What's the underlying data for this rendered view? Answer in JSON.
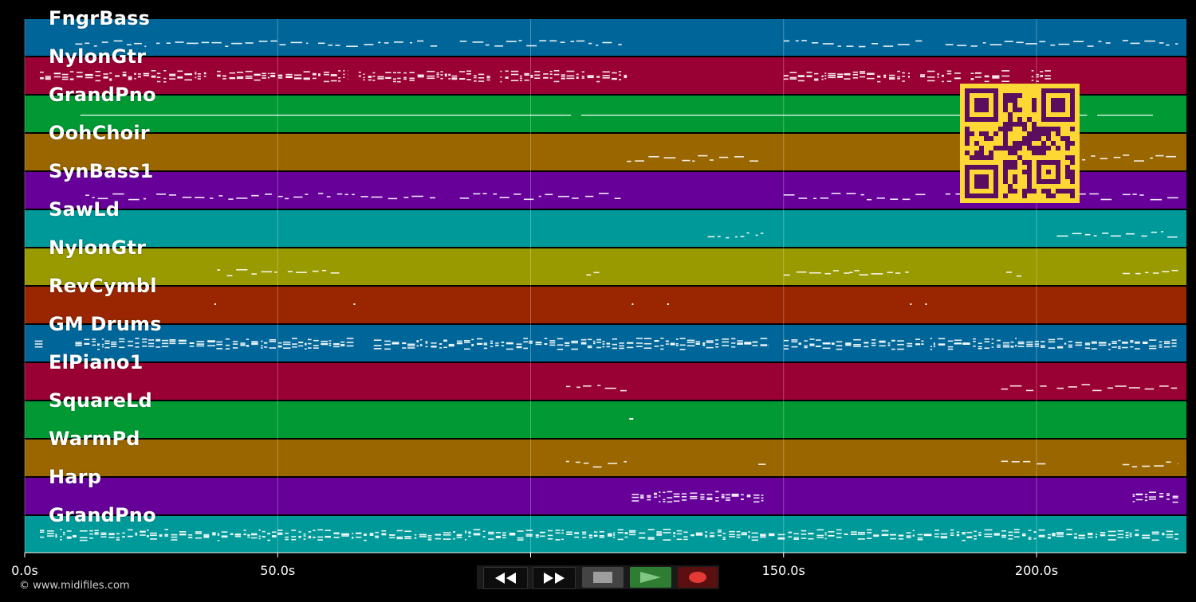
{
  "tracks": [
    {
      "name": "FngrBass",
      "color": "#006699",
      "notes": [
        [
          10,
          24
        ],
        [
          26,
          56
        ],
        [
          58,
          82
        ],
        [
          86,
          118
        ],
        [
          150,
          178
        ],
        [
          182,
          215
        ],
        [
          217,
          228
        ]
      ],
      "density": "sparse"
    },
    {
      "name": "NylonGtr",
      "color": "#990033",
      "notes": [
        [
          3,
          36
        ],
        [
          38,
          64
        ],
        [
          66,
          92
        ],
        [
          94,
          119
        ],
        [
          150,
          175
        ],
        [
          177,
          185
        ],
        [
          187,
          195
        ],
        [
          199,
          203
        ]
      ],
      "density": "dense"
    },
    {
      "name": "GrandPno",
      "color": "#009933",
      "notes": [
        [
          11,
          108
        ],
        [
          110,
          210
        ],
        [
          212,
          223
        ]
      ],
      "density": "line"
    },
    {
      "name": "OohChoir",
      "color": "#996600",
      "notes": [
        [
          119,
          145
        ],
        [
          209,
          228
        ]
      ],
      "density": "sparse"
    },
    {
      "name": "SynBass1",
      "color": "#660099",
      "notes": [
        [
          12,
          24
        ],
        [
          26,
          56
        ],
        [
          58,
          82
        ],
        [
          86,
          118
        ],
        [
          150,
          178
        ],
        [
          182,
          215
        ],
        [
          217,
          228
        ]
      ],
      "density": "sparse"
    },
    {
      "name": "SawLd",
      "color": "#009999",
      "notes": [
        [
          135,
          146
        ],
        [
          204,
          228
        ]
      ],
      "density": "sparse"
    },
    {
      "name": "NylonGtr",
      "color": "#999900",
      "notes": [
        [
          38,
          50
        ],
        [
          52,
          63
        ],
        [
          111,
          114
        ],
        [
          150,
          165
        ],
        [
          163,
          175
        ],
        [
          194,
          197
        ],
        [
          217,
          228
        ]
      ],
      "density": "sparse"
    },
    {
      "name": "RevCymbl",
      "color": "#992600",
      "notes": [
        [
          37.5,
          37.8
        ],
        [
          65,
          65.3
        ],
        [
          120,
          120.3
        ],
        [
          127,
          127.3
        ],
        [
          175,
          175.3
        ],
        [
          178,
          178.3
        ]
      ],
      "density": "dots"
    },
    {
      "name": "GM Drums",
      "color": "#006699",
      "notes": [
        [
          2,
          4
        ],
        [
          10,
          65
        ],
        [
          69,
          119
        ],
        [
          119,
          147
        ],
        [
          150,
          178
        ],
        [
          179,
          228
        ]
      ],
      "density": "dense"
    },
    {
      "name": "ElPiano1",
      "color": "#990033",
      "notes": [
        [
          107,
          119
        ],
        [
          193,
          202
        ],
        [
          204,
          228
        ]
      ],
      "density": "sparse"
    },
    {
      "name": "SquareLd",
      "color": "#009933",
      "notes": [
        [
          119.5,
          120.3
        ]
      ],
      "density": "dots"
    },
    {
      "name": "WarmPd",
      "color": "#996600",
      "notes": [
        [
          107,
          119
        ],
        [
          145,
          146.5
        ],
        [
          193,
          202
        ],
        [
          217,
          228
        ]
      ],
      "density": "sparse"
    },
    {
      "name": "Harp",
      "color": "#660099",
      "notes": [
        [
          120,
          146
        ],
        [
          219,
          228
        ]
      ],
      "density": "dense"
    },
    {
      "name": "GrandPno",
      "color": "#009999",
      "notes": [
        [
          3,
          228
        ]
      ],
      "density": "dense"
    }
  ],
  "timeline": {
    "ticks": [
      {
        "value": 0,
        "label": "0.0s"
      },
      {
        "value": 50,
        "label": "50.0s"
      },
      {
        "value": 100,
        "label": "100.0s"
      },
      {
        "value": 150,
        "label": "150.0s"
      },
      {
        "value": 200,
        "label": "200.0s"
      }
    ],
    "max_seconds": 230
  },
  "copyright": "© www.midifiles.com",
  "transport": {
    "rewind_icon": "rewind-icon",
    "fast_forward_icon": "fast-forward-icon",
    "stop_icon": "stop-icon",
    "play_icon": "play-icon",
    "record_icon": "record-icon",
    "colors": {
      "play": "#2e7d32",
      "record": "#b71c1c",
      "stop": "#444444"
    }
  },
  "qr_code": {
    "fg": "#5b0d5e",
    "bg": "#fdd835"
  }
}
